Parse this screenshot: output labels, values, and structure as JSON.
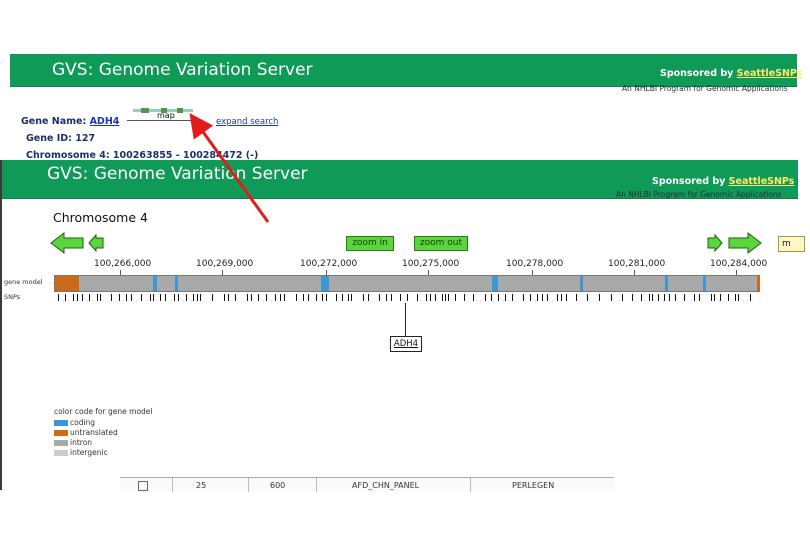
{
  "back": {
    "header_title": "GVS: Genome Variation Server",
    "sponsored_prefix": "Sponsored by",
    "sponsor_link": "SeattleSNPs",
    "subline": "An NHLBI Program for Genomic Applications",
    "gene_name_label": "Gene Name:",
    "gene_name_value": "ADH4",
    "map_label": "map",
    "expand_search": "expand search",
    "gene_id": "Gene ID: 127",
    "chromosome_line": "Chromosome 4: 100263855 - 100284472 (-)"
  },
  "front": {
    "header_title": "GVS: Genome Variation Server",
    "sponsored_prefix": "Sponsored by",
    "sponsor_link": "SeattleSNPs",
    "subline": "An NHLBI Program for Genomic Applications",
    "chromosome_title": "Chromosome 4",
    "zoom_in": "zoom in",
    "zoom_out": "zoom out",
    "edge_button": "m",
    "ticks": [
      "100,266,000",
      "100,269,000",
      "100,272,000",
      "100,275,000",
      "100,278,000",
      "100,281,000",
      "100,284,000"
    ],
    "row_gene_model": "gene model",
    "row_snps": "SNPs",
    "gene_label": "ADH4",
    "legend_title": "color code for gene model",
    "legend": [
      {
        "label": "coding",
        "color": "#3c98d3"
      },
      {
        "label": "untranslated",
        "color": "#cc6a1a"
      },
      {
        "label": "intron",
        "color": "#a9a9a9"
      },
      {
        "label": "intergenic",
        "color": "#cdcdcd"
      }
    ],
    "table_cells": [
      "25",
      "600",
      "AFD_CHN_PANEL",
      "PERLEGEN"
    ]
  },
  "colors": {
    "header_green": "#0f9a57",
    "sponsor_yellow": "#ffe96b",
    "button_green": "#58d63a",
    "annotation_red": "#e21b1b"
  }
}
